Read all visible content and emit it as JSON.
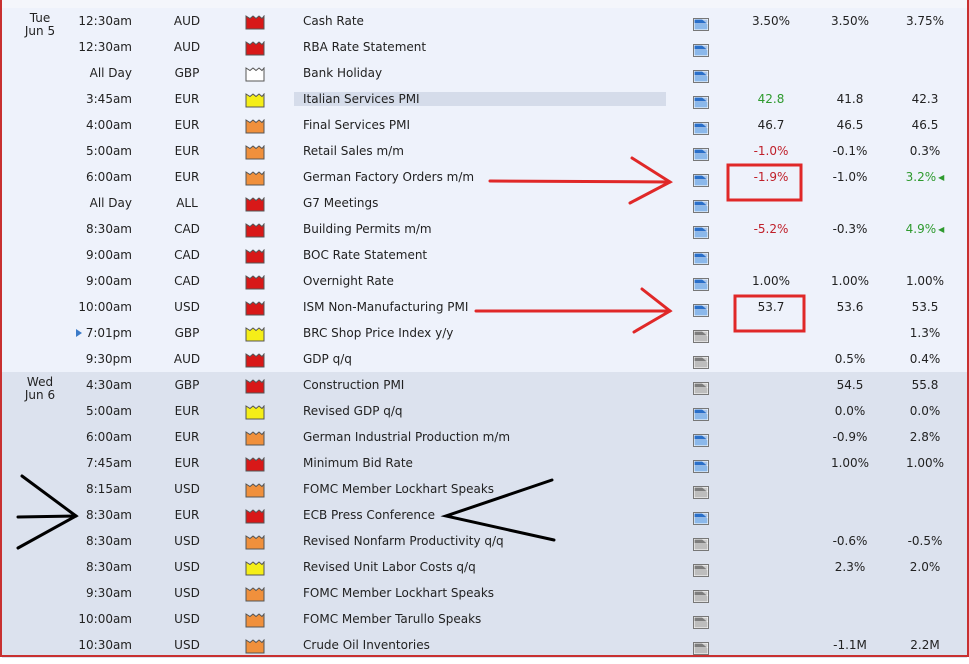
{
  "colors": {
    "impact_high": "#d81818",
    "impact_medium": "#f0903c",
    "impact_low": "#f5ee18",
    "impact_none": "#ffffff",
    "positive": "#2e9a2e",
    "negative": "#c0202a",
    "annotation": "#e02828"
  },
  "days": [
    {
      "day": "Tue",
      "date": "Jun 5",
      "events": [
        {
          "time": "12:30am",
          "currency": "AUD",
          "impact": "high",
          "event": "Cash Rate",
          "alert": "blue",
          "actual": "3.50%",
          "forecast": "3.50%",
          "previous": "3.75%"
        },
        {
          "time": "12:30am",
          "currency": "AUD",
          "impact": "high",
          "event": "RBA Rate Statement",
          "alert": "blue",
          "actual": "",
          "forecast": "",
          "previous": ""
        },
        {
          "time": "All Day",
          "currency": "GBP",
          "impact": "none",
          "event": "Bank Holiday",
          "alert": "blue",
          "actual": "",
          "forecast": "",
          "previous": ""
        },
        {
          "time": "3:45am",
          "currency": "EUR",
          "impact": "low",
          "event": "Italian Services PMI",
          "highlight": true,
          "alert": "blue",
          "actual": "42.8",
          "actual_color": "green",
          "forecast": "41.8",
          "previous": "42.3"
        },
        {
          "time": "4:00am",
          "currency": "EUR",
          "impact": "medium",
          "event": "Final Services PMI",
          "alert": "blue",
          "actual": "46.7",
          "forecast": "46.5",
          "previous": "46.5"
        },
        {
          "time": "5:00am",
          "currency": "EUR",
          "impact": "medium",
          "event": "Retail Sales m/m",
          "alert": "blue",
          "actual": "-1.0%",
          "actual_color": "red",
          "forecast": "-0.1%",
          "previous": "0.3%"
        },
        {
          "time": "6:00am",
          "currency": "EUR",
          "impact": "medium",
          "event": "German Factory Orders m/m",
          "alert": "blue",
          "actual": "-1.9%",
          "actual_color": "red",
          "forecast": "-1.0%",
          "previous": "3.2%",
          "previous_color": "green",
          "revised": true
        },
        {
          "time": "All Day",
          "currency": "ALL",
          "impact": "high",
          "event": "G7 Meetings",
          "alert": "blue",
          "actual": "",
          "forecast": "",
          "previous": ""
        },
        {
          "time": "8:30am",
          "currency": "CAD",
          "impact": "high",
          "event": "Building Permits m/m",
          "alert": "blue",
          "actual": "-5.2%",
          "actual_color": "red",
          "forecast": "-0.3%",
          "previous": "4.9%",
          "previous_color": "green",
          "revised": true
        },
        {
          "time": "9:00am",
          "currency": "CAD",
          "impact": "high",
          "event": "BOC Rate Statement",
          "alert": "blue",
          "actual": "",
          "forecast": "",
          "previous": ""
        },
        {
          "time": "9:00am",
          "currency": "CAD",
          "impact": "high",
          "event": "Overnight Rate",
          "alert": "blue",
          "actual": "1.00%",
          "forecast": "1.00%",
          "previous": "1.00%"
        },
        {
          "time": "10:00am",
          "currency": "USD",
          "impact": "high",
          "event": "ISM Non-Manufacturing PMI",
          "alert": "blue",
          "actual": "53.7",
          "forecast": "53.6",
          "previous": "53.5"
        },
        {
          "time": "7:01pm",
          "currency": "GBP",
          "impact": "low",
          "event": "BRC Shop Price Index y/y",
          "alert": "gray",
          "actual": "",
          "forecast": "",
          "previous": "1.3%",
          "upcoming": true
        },
        {
          "time": "9:30pm",
          "currency": "AUD",
          "impact": "high",
          "event": "GDP q/q",
          "alert": "gray",
          "actual": "",
          "forecast": "0.5%",
          "previous": "0.4%"
        }
      ]
    },
    {
      "day": "Wed",
      "date": "Jun 6",
      "events": [
        {
          "time": "4:30am",
          "currency": "GBP",
          "impact": "high",
          "event": "Construction PMI",
          "alert": "gray",
          "actual": "",
          "forecast": "54.5",
          "previous": "55.8"
        },
        {
          "time": "5:00am",
          "currency": "EUR",
          "impact": "low",
          "event": "Revised GDP q/q",
          "alert": "blue",
          "actual": "",
          "forecast": "0.0%",
          "previous": "0.0%"
        },
        {
          "time": "6:00am",
          "currency": "EUR",
          "impact": "medium",
          "event": "German Industrial Production m/m",
          "alert": "blue",
          "actual": "",
          "forecast": "-0.9%",
          "previous": "2.8%"
        },
        {
          "time": "7:45am",
          "currency": "EUR",
          "impact": "high",
          "event": "Minimum Bid Rate",
          "alert": "blue",
          "actual": "",
          "forecast": "1.00%",
          "previous": "1.00%"
        },
        {
          "time": "8:15am",
          "currency": "USD",
          "impact": "medium",
          "event": "FOMC Member Lockhart Speaks",
          "alert": "gray",
          "actual": "",
          "forecast": "",
          "previous": ""
        },
        {
          "time": "8:30am",
          "currency": "EUR",
          "impact": "high",
          "event": "ECB Press Conference",
          "alert": "blue",
          "actual": "",
          "forecast": "",
          "previous": ""
        },
        {
          "time": "8:30am",
          "currency": "USD",
          "impact": "medium",
          "event": "Revised Nonfarm Productivity q/q",
          "alert": "gray",
          "actual": "",
          "forecast": "-0.6%",
          "previous": "-0.5%"
        },
        {
          "time": "8:30am",
          "currency": "USD",
          "impact": "low",
          "event": "Revised Unit Labor Costs q/q",
          "alert": "gray",
          "actual": "",
          "forecast": "2.3%",
          "previous": "2.0%"
        },
        {
          "time": "9:30am",
          "currency": "USD",
          "impact": "medium",
          "event": "FOMC Member Lockhart Speaks",
          "alert": "gray",
          "actual": "",
          "forecast": "",
          "previous": ""
        },
        {
          "time": "10:00am",
          "currency": "USD",
          "impact": "medium",
          "event": "FOMC Member Tarullo Speaks",
          "alert": "gray",
          "actual": "",
          "forecast": "",
          "previous": ""
        },
        {
          "time": "10:30am",
          "currency": "USD",
          "impact": "medium",
          "event": "Crude Oil Inventories",
          "alert": "gray",
          "actual": "",
          "forecast": "-1.1M",
          "previous": "2.2M"
        }
      ]
    }
  ]
}
